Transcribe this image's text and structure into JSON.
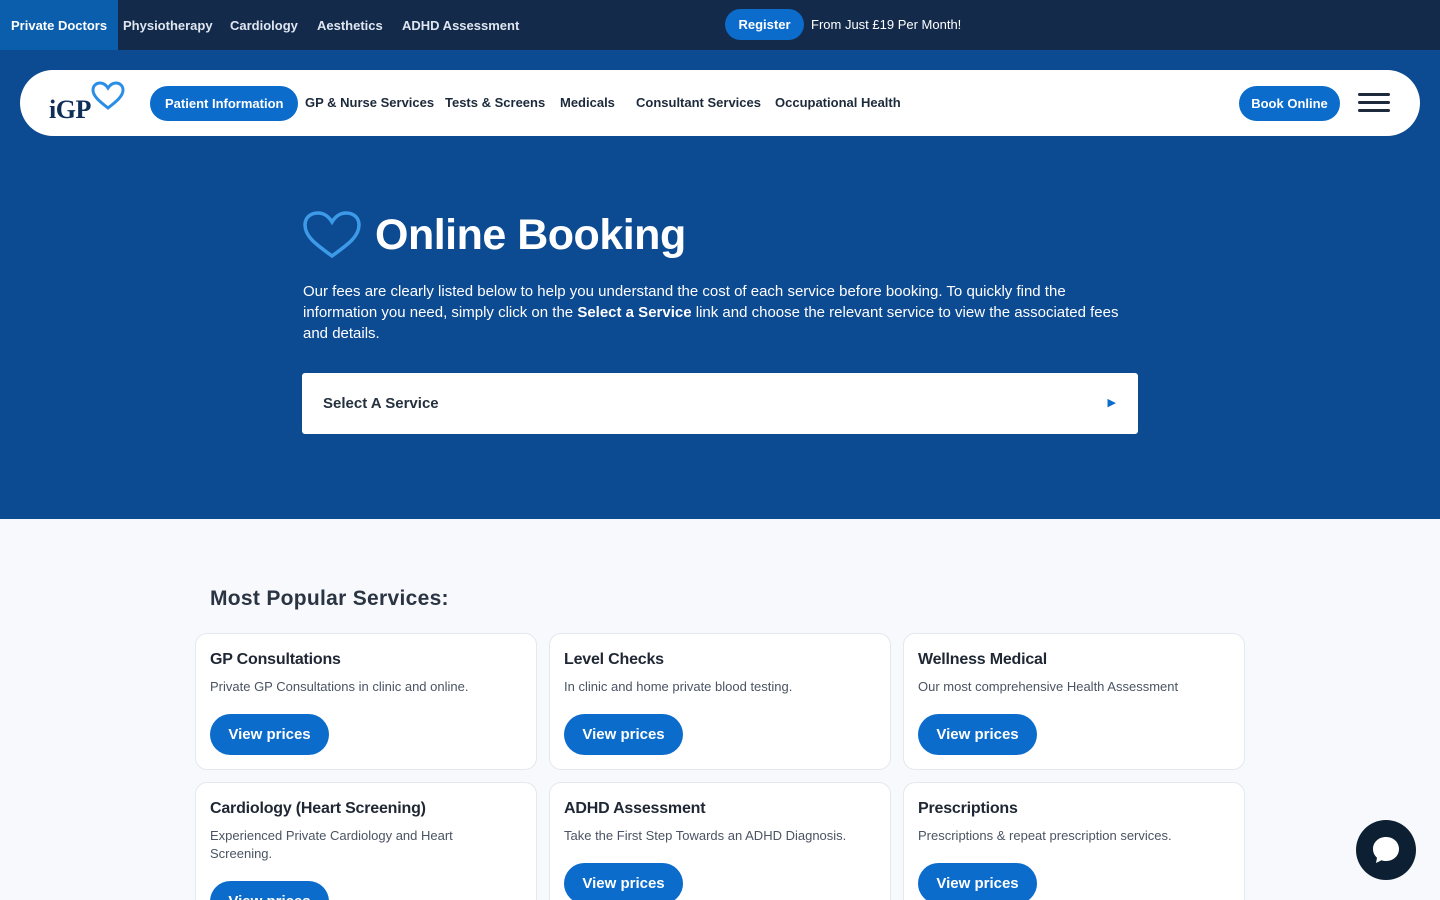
{
  "topbar": {
    "tabs": [
      "Private Doctors",
      "Physiotherapy",
      "Cardiology",
      "Aesthetics",
      "ADHD Assessment"
    ],
    "register_label": "Register",
    "promo": "From Just £19 Per Month!"
  },
  "nav": {
    "logo_text": "iGP",
    "items": [
      "Patient Information",
      "GP & Nurse Services",
      "Tests & Screens",
      "Medicals",
      "Consultant Services",
      "Occupational Health"
    ],
    "book_label": "Book Online"
  },
  "hero": {
    "title": "Online Booking",
    "desc_before": "Our fees are clearly listed below to help you understand the cost of each service before booking. To quickly find the information you need, simply click on the ",
    "desc_bold": "Select a Service",
    "desc_after": " link and choose the relevant service to view the associated fees and details.",
    "select_label": "Select A Service"
  },
  "popular": {
    "title": "Most Popular Services:",
    "button_label": "View prices",
    "cards": [
      {
        "title": "GP Consultations",
        "desc": "Private GP Consultations in clinic and online."
      },
      {
        "title": "Level Checks",
        "desc": "In clinic and home private blood testing."
      },
      {
        "title": "Wellness Medical",
        "desc": "Our most comprehensive Health Assessment"
      },
      {
        "title": "Cardiology (Heart Screening)",
        "desc": "Experienced Private Cardiology and Heart Screening."
      },
      {
        "title": "ADHD Assessment",
        "desc": "Take the First Step Towards an ADHD Diagnosis."
      },
      {
        "title": "Prescriptions",
        "desc": "Prescriptions & repeat prescription services."
      }
    ]
  },
  "colors": {
    "primary": "#0b6ccc",
    "hero_bg": "#0c4a92",
    "topbar_bg": "#132a4b"
  },
  "icons": [
    "heart-icon",
    "play-arrow-icon",
    "hamburger-menu-icon",
    "chat-bubble-icon"
  ]
}
